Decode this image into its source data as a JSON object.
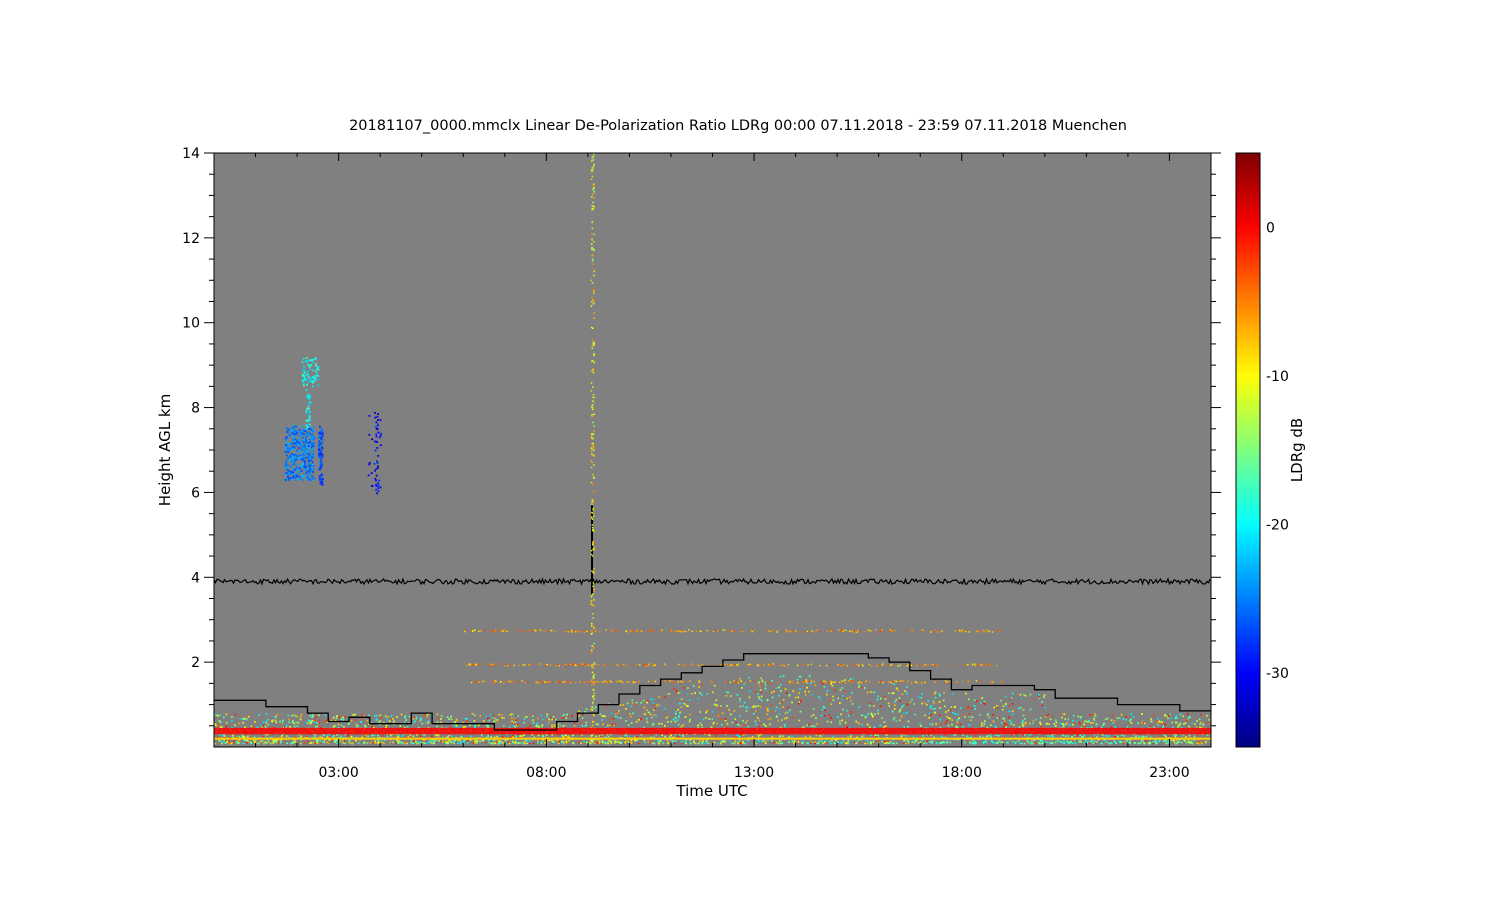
{
  "chart_data": {
    "type": "heatmap",
    "title": "20181107_0000.mmclx Linear De-Polarization Ratio LDRg   00:00 07.11.2018 - 23:59 07.11.2018 Muenchen",
    "xlabel": "Time UTC",
    "ylabel": "Height AGL km",
    "xlim_hours": [
      0,
      24
    ],
    "ylim_km": [
      0,
      14
    ],
    "x_ticks": [
      {
        "value": 3,
        "label": "03:00"
      },
      {
        "value": 8,
        "label": "08:00"
      },
      {
        "value": 13,
        "label": "13:00"
      },
      {
        "value": 18,
        "label": "18:00"
      },
      {
        "value": 23,
        "label": "23:00"
      }
    ],
    "y_ticks": [
      {
        "value": 2,
        "label": "2"
      },
      {
        "value": 4,
        "label": "4"
      },
      {
        "value": 6,
        "label": "6"
      },
      {
        "value": 8,
        "label": "8"
      },
      {
        "value": 10,
        "label": "10"
      },
      {
        "value": 12,
        "label": "12"
      },
      {
        "value": 14,
        "label": "14"
      }
    ],
    "colorbar": {
      "label": "LDRg dB",
      "range": [
        -35,
        5
      ],
      "ticks": [
        {
          "value": 0,
          "label": "0"
        },
        {
          "value": -10,
          "label": "-10"
        },
        {
          "value": -20,
          "label": "-20"
        },
        {
          "value": -30,
          "label": "-30"
        }
      ],
      "colormap": [
        "#00007f",
        "#0000ff",
        "#007fff",
        "#00ffff",
        "#7fff7f",
        "#ffff00",
        "#ff7f00",
        "#ff0000",
        "#7f0000"
      ]
    },
    "background_color": "#808080",
    "series": [
      {
        "type": "step",
        "points": [
          [
            0,
            1.1
          ],
          [
            1.25,
            1.1
          ],
          [
            1.25,
            0.95
          ],
          [
            2.25,
            0.95
          ],
          [
            2.25,
            0.8
          ],
          [
            2.75,
            0.8
          ],
          [
            2.75,
            0.6
          ],
          [
            3.25,
            0.6
          ],
          [
            3.25,
            0.7
          ],
          [
            3.75,
            0.7
          ],
          [
            3.75,
            0.55
          ],
          [
            4.75,
            0.55
          ],
          [
            4.75,
            0.8
          ],
          [
            5.25,
            0.8
          ],
          [
            5.25,
            0.55
          ],
          [
            6.75,
            0.55
          ],
          [
            6.75,
            0.4
          ],
          [
            8.25,
            0.4
          ],
          [
            8.25,
            0.6
          ],
          [
            8.75,
            0.6
          ],
          [
            8.75,
            0.8
          ],
          [
            9.25,
            0.8
          ],
          [
            9.25,
            1.0
          ],
          [
            9.75,
            1.0
          ],
          [
            9.75,
            1.25
          ],
          [
            10.25,
            1.25
          ],
          [
            10.25,
            1.45
          ],
          [
            10.75,
            1.45
          ],
          [
            10.75,
            1.6
          ],
          [
            11.25,
            1.6
          ],
          [
            11.25,
            1.75
          ],
          [
            11.75,
            1.75
          ],
          [
            11.75,
            1.9
          ],
          [
            12.25,
            1.9
          ],
          [
            12.25,
            2.05
          ],
          [
            12.75,
            2.05
          ],
          [
            12.75,
            2.2
          ],
          [
            15.75,
            2.2
          ],
          [
            15.75,
            2.1
          ],
          [
            16.25,
            2.1
          ],
          [
            16.25,
            2.0
          ],
          [
            16.75,
            2.0
          ],
          [
            16.75,
            1.8
          ],
          [
            17.25,
            1.8
          ],
          [
            17.25,
            1.6
          ],
          [
            17.75,
            1.6
          ],
          [
            17.75,
            1.35
          ],
          [
            18.25,
            1.35
          ],
          [
            18.25,
            1.45
          ],
          [
            19.75,
            1.45
          ],
          [
            19.75,
            1.35
          ],
          [
            20.25,
            1.35
          ],
          [
            20.25,
            1.15
          ],
          [
            21.75,
            1.15
          ],
          [
            21.75,
            1.0
          ],
          [
            23.25,
            1.0
          ],
          [
            23.25,
            0.85
          ],
          [
            24,
            0.85
          ]
        ]
      },
      {
        "type": "line",
        "approx_height_km": 3.9
      }
    ],
    "features": [
      {
        "kind": "ice-cloud",
        "time_range_hours": [
          1.7,
          2.4
        ],
        "height_km": [
          6.3,
          7.6
        ],
        "ldr_db": -25
      },
      {
        "kind": "ice-cloud-top",
        "time_range_hours": [
          2.1,
          2.5
        ],
        "height_km": [
          7.5,
          9.2
        ],
        "ldr_db": -20
      },
      {
        "kind": "cloud-streak",
        "time_range_hours": [
          2.5,
          2.6
        ],
        "height_km": [
          6.2,
          7.6
        ],
        "ldr_db": -27
      },
      {
        "kind": "cloud-patch",
        "time_range_hours": [
          3.7,
          4.0
        ],
        "height_km": [
          6.0,
          7.9
        ],
        "ldr_db": -30
      },
      {
        "kind": "vertical-spike",
        "time_hours": 9.1,
        "height_km": [
          3.6,
          5.7
        ]
      },
      {
        "kind": "vertical-speckle",
        "time_hours": 9.1,
        "height_km": [
          0.1,
          14
        ],
        "ldr_db": -8
      },
      {
        "kind": "boundary-layer-speckle",
        "time_range_hours": [
          0,
          24
        ],
        "height_km": [
          0.1,
          1.9
        ],
        "ldr_db_range": [
          -20,
          0
        ]
      },
      {
        "kind": "ground-clutter-band",
        "time_range_hours": [
          0,
          24
        ],
        "height_km": [
          0.3,
          0.45
        ],
        "ldr_db": 0
      }
    ]
  }
}
